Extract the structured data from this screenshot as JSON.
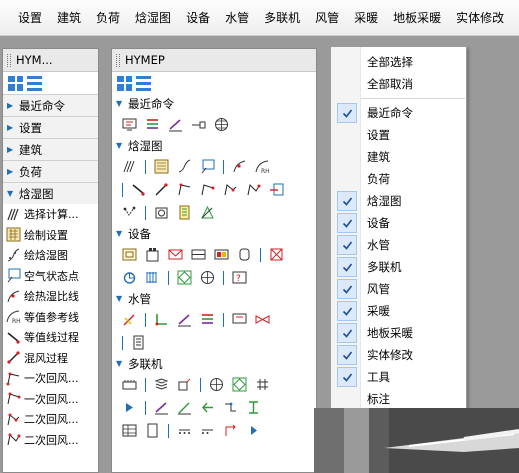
{
  "menubar": {
    "items": [
      "设置",
      "建筑",
      "负荷",
      "焓湿图",
      "设备",
      "水管",
      "多联机",
      "风管",
      "采暖",
      "地板采暖",
      "实体修改"
    ]
  },
  "left_panel": {
    "title": "HYM...",
    "sections": [
      {
        "label": "最近命令",
        "expanded": false
      },
      {
        "label": "设置",
        "expanded": false
      },
      {
        "label": "建筑",
        "expanded": false
      },
      {
        "label": "负荷",
        "expanded": false
      },
      {
        "label": "焓湿图",
        "expanded": true
      }
    ],
    "items": [
      {
        "label": "选择计算...",
        "icon": "select-calc-icon"
      },
      {
        "label": "绘制设置",
        "icon": "draw-settings-icon"
      },
      {
        "label": "绘焓湿图",
        "icon": "draw-psychro-icon"
      },
      {
        "label": "空气状态点",
        "icon": "air-state-icon"
      },
      {
        "label": "绘热湿比线",
        "icon": "heat-moisture-line-icon"
      },
      {
        "label": "等值参考线",
        "icon": "rh-curve-icon"
      },
      {
        "label": "等值线过程",
        "icon": "iso-process-icon"
      },
      {
        "label": "混风过程",
        "icon": "mix-air-icon"
      },
      {
        "label": "一次回风...",
        "icon": "primary-return-icon"
      },
      {
        "label": "一次回风...",
        "icon": "primary-return-icon"
      },
      {
        "label": "二次回风...",
        "icon": "secondary-return-icon"
      },
      {
        "label": "二次回风...",
        "icon": "secondary-return-icon"
      }
    ]
  },
  "mid_panel": {
    "title": "HYMEP",
    "groups": [
      {
        "label": "最近命令"
      },
      {
        "label": "焓湿图"
      },
      {
        "label": "设备"
      },
      {
        "label": "水管"
      },
      {
        "label": "多联机"
      }
    ]
  },
  "popup_menu": {
    "items": [
      {
        "label": "全部选择",
        "checked": false
      },
      {
        "label": "全部取消",
        "checked": false
      },
      {
        "label": "最近命令",
        "checked": true
      },
      {
        "label": "设置",
        "checked": false
      },
      {
        "label": "建筑",
        "checked": false
      },
      {
        "label": "负荷",
        "checked": false
      },
      {
        "label": "焓湿图",
        "checked": true
      },
      {
        "label": "设备",
        "checked": true
      },
      {
        "label": "水管",
        "checked": true
      },
      {
        "label": "多联机",
        "checked": true
      },
      {
        "label": "风管",
        "checked": true
      },
      {
        "label": "采暖",
        "checked": true
      },
      {
        "label": "地板采暖",
        "checked": true
      },
      {
        "label": "实体修改",
        "checked": true
      },
      {
        "label": "工具",
        "checked": true
      },
      {
        "label": "标注",
        "checked": false
      }
    ]
  },
  "colors": {
    "accent_blue": "#1f6fb8",
    "check_bg": "#dbe9fa",
    "icon_red": "#d42020",
    "icon_purple": "#7a2ca0",
    "icon_green": "#2e9b3a",
    "icon_yellow": "#e6b800"
  }
}
